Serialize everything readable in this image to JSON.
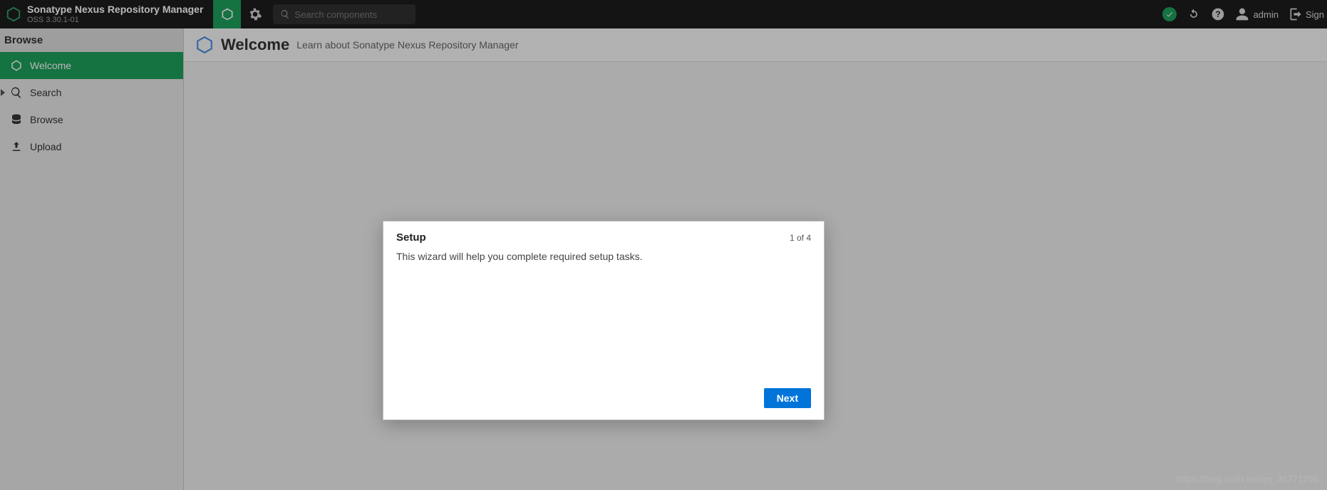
{
  "header": {
    "brand_title": "Sonatype Nexus Repository Manager",
    "brand_sub": "OSS 3.30.1-01",
    "search_placeholder": "Search components",
    "user_name": "admin",
    "signout_label": "Sign out"
  },
  "sidebar": {
    "heading": "Browse",
    "items": [
      {
        "label": "Welcome"
      },
      {
        "label": "Search"
      },
      {
        "label": "Browse"
      },
      {
        "label": "Upload"
      }
    ]
  },
  "page": {
    "title": "Welcome",
    "subtitle": "Learn about Sonatype Nexus Repository Manager"
  },
  "modal": {
    "title": "Setup",
    "step": "1 of 4",
    "body": "This wizard will help you complete required setup tasks.",
    "next_label": "Next"
  },
  "watermark": "https://blog.csdn.net/qq_35771266"
}
